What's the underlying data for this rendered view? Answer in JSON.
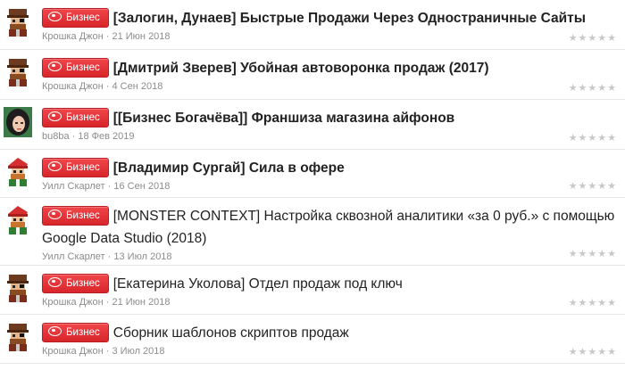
{
  "threads": [
    {
      "title": "[Залогин, Дунаев] Быстрые Продажи Через Одностраничные Сайты",
      "bold": true,
      "author": "Крошка Джон",
      "date": "21 Июн 2018",
      "avatar": "pirate"
    },
    {
      "title": "[Дмитрий Зверев] Убойная автоворонка продаж (2017)",
      "bold": true,
      "author": "Крошка Джон",
      "date": "4 Сен 2018",
      "avatar": "pirate"
    },
    {
      "title": "[[Бизнес Богачёва]] Франшиза магазина айфонов",
      "bold": true,
      "author": "bu8ba",
      "date": "18 Фев 2019",
      "avatar": "girl"
    },
    {
      "title": "[Владимир Сургай] Сила в офере",
      "bold": true,
      "author": "Уилл Скарлет",
      "date": "16 Сен 2018",
      "avatar": "redhat"
    },
    {
      "title": "[MONSTER CONTEXT] Настройка сквозной аналитики «за 0 руб.» с помощью Google Data Studio (2018)",
      "bold": false,
      "author": "Уилл Скарлет",
      "date": "13 Июл 2018",
      "avatar": "redhat"
    },
    {
      "title": "[Екатерина Уколова] Отдел продаж под ключ",
      "bold": false,
      "author": "Крошка Джон",
      "date": "21 Июн 2018",
      "avatar": "pirate"
    },
    {
      "title": "Сборник шаблонов скриптов продаж",
      "bold": false,
      "author": "Крошка Джон",
      "date": "3 Июл 2018",
      "avatar": "pirate"
    }
  ],
  "badge_label": "Бизнес",
  "separator": " · ",
  "rating_stars": "★★★★★",
  "colors": {
    "badge": "#e0292e",
    "meta": "#8c8c8c",
    "stars": "#c8c8c8"
  }
}
